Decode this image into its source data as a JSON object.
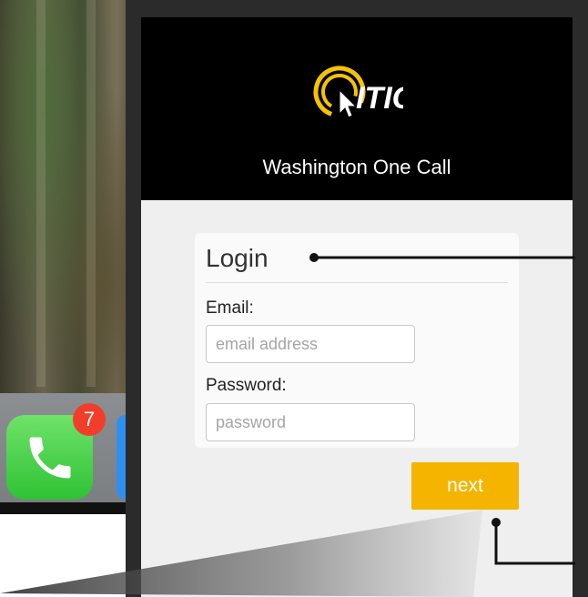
{
  "background_phone": {
    "phone_badge_count": "7"
  },
  "header": {
    "logo_text": "ITIC",
    "brand_name": "Washington One Call"
  },
  "login": {
    "title": "Login",
    "email_label": "Email:",
    "email_placeholder": "email address",
    "password_label": "Password:",
    "password_placeholder": "password",
    "next_label": "next"
  },
  "colors": {
    "accent": "#f5b400",
    "header_bg": "#000000",
    "badge": "#f23d2b",
    "phone_app": "#2fc234"
  }
}
